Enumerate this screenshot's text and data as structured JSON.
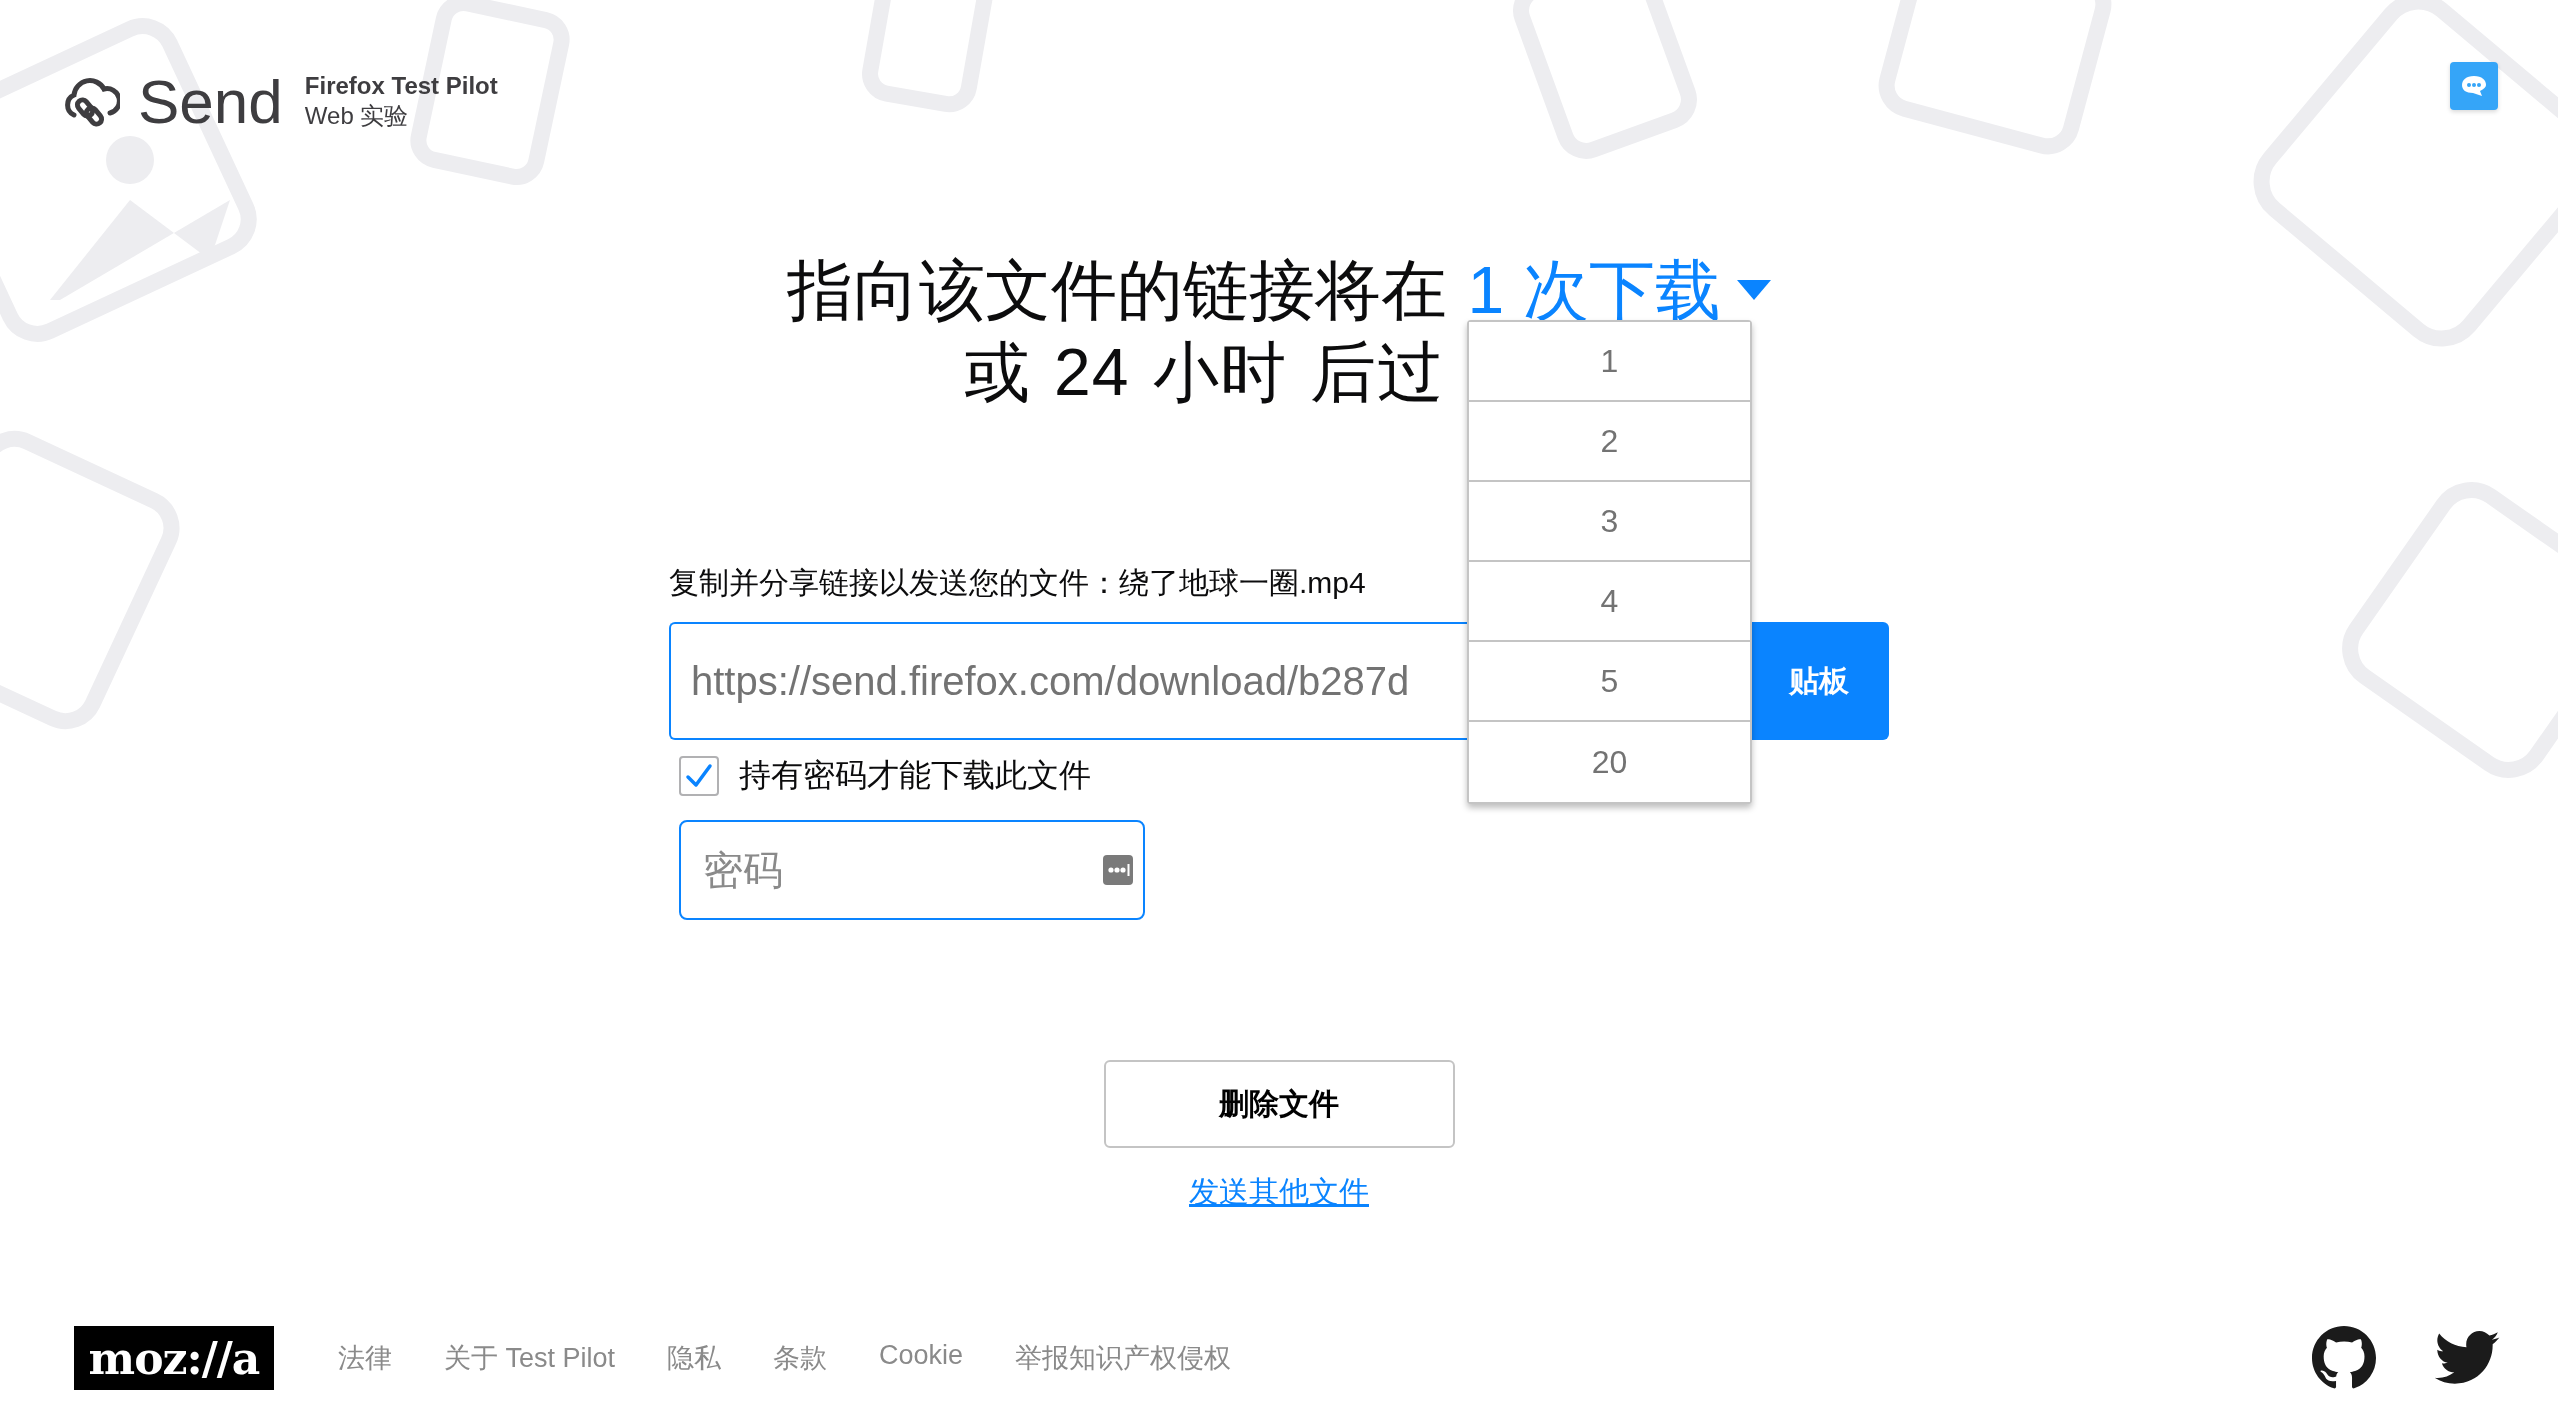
{
  "header": {
    "logo_text": "Send",
    "product": "Firefox Test Pilot",
    "tagline": "Web 实验"
  },
  "title": {
    "prefix": "指向该文件的链接将在",
    "downloads": "1 次下载",
    "line2": "或 24 小时 后过"
  },
  "dropdown": {
    "expanded": true,
    "options": [
      {
        "label": "1",
        "selected": false
      },
      {
        "label": "2",
        "selected": false
      },
      {
        "label": "3",
        "selected": false
      },
      {
        "label": "4",
        "selected": false
      },
      {
        "label": "5",
        "selected": false
      },
      {
        "label": "20",
        "selected": false
      }
    ]
  },
  "share": {
    "label": "复制并分享链接以发送您的文件：绕了地球一圈.mp4",
    "url": "https://send.firefox.com/download/b287d",
    "copy_button": "贴板"
  },
  "password": {
    "checked": true,
    "label": "持有密码才能下载此文件",
    "placeholder": "密码"
  },
  "delete_button": "删除文件",
  "send_another": "发送其他文件",
  "footer": {
    "logo": "moz://a",
    "links": [
      "法律",
      "关于 Test Pilot",
      "隐私",
      "条款",
      "Cookie",
      "举报知识产权侵权"
    ]
  }
}
